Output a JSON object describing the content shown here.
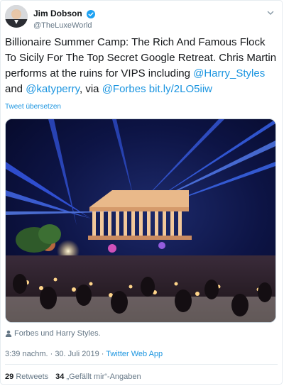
{
  "author": {
    "name": "Jim Dobson",
    "handle": "@TheLuxeWorld",
    "verified": true
  },
  "tweet": {
    "text_part1": "Billionaire Summer Camp: The Rich And Famous Flock To Sicily For The Top Secret Google Retreat. Chris Martin performs at the ruins for VIPS including ",
    "mention_harry": "@Harry_Styles",
    "text_and": " and ",
    "mention_katy": "@katyperry",
    "text_via": ", via ",
    "mention_forbes": "@Forbes",
    "text_space": " ",
    "short_link": "bit.ly/2LO5iiw"
  },
  "translate_label": "Tweet übersetzen",
  "tagged": "Forbes und Harry Styles.",
  "meta": {
    "timestamp": "3:39 nachm. · 30. Juli 2019 · ",
    "source": "Twitter Web App"
  },
  "stats": {
    "retweets_count": "29",
    "retweets_label": "Retweets",
    "likes_count": "34",
    "likes_label": "„Gefällt mir“-Angaben"
  },
  "icons": {
    "verified": "verified-badge-icon",
    "caret": "chevron-down-icon",
    "person": "person-icon"
  },
  "colors": {
    "link": "#1b95e0",
    "secondary": "#657786",
    "primary": "#14171a"
  }
}
